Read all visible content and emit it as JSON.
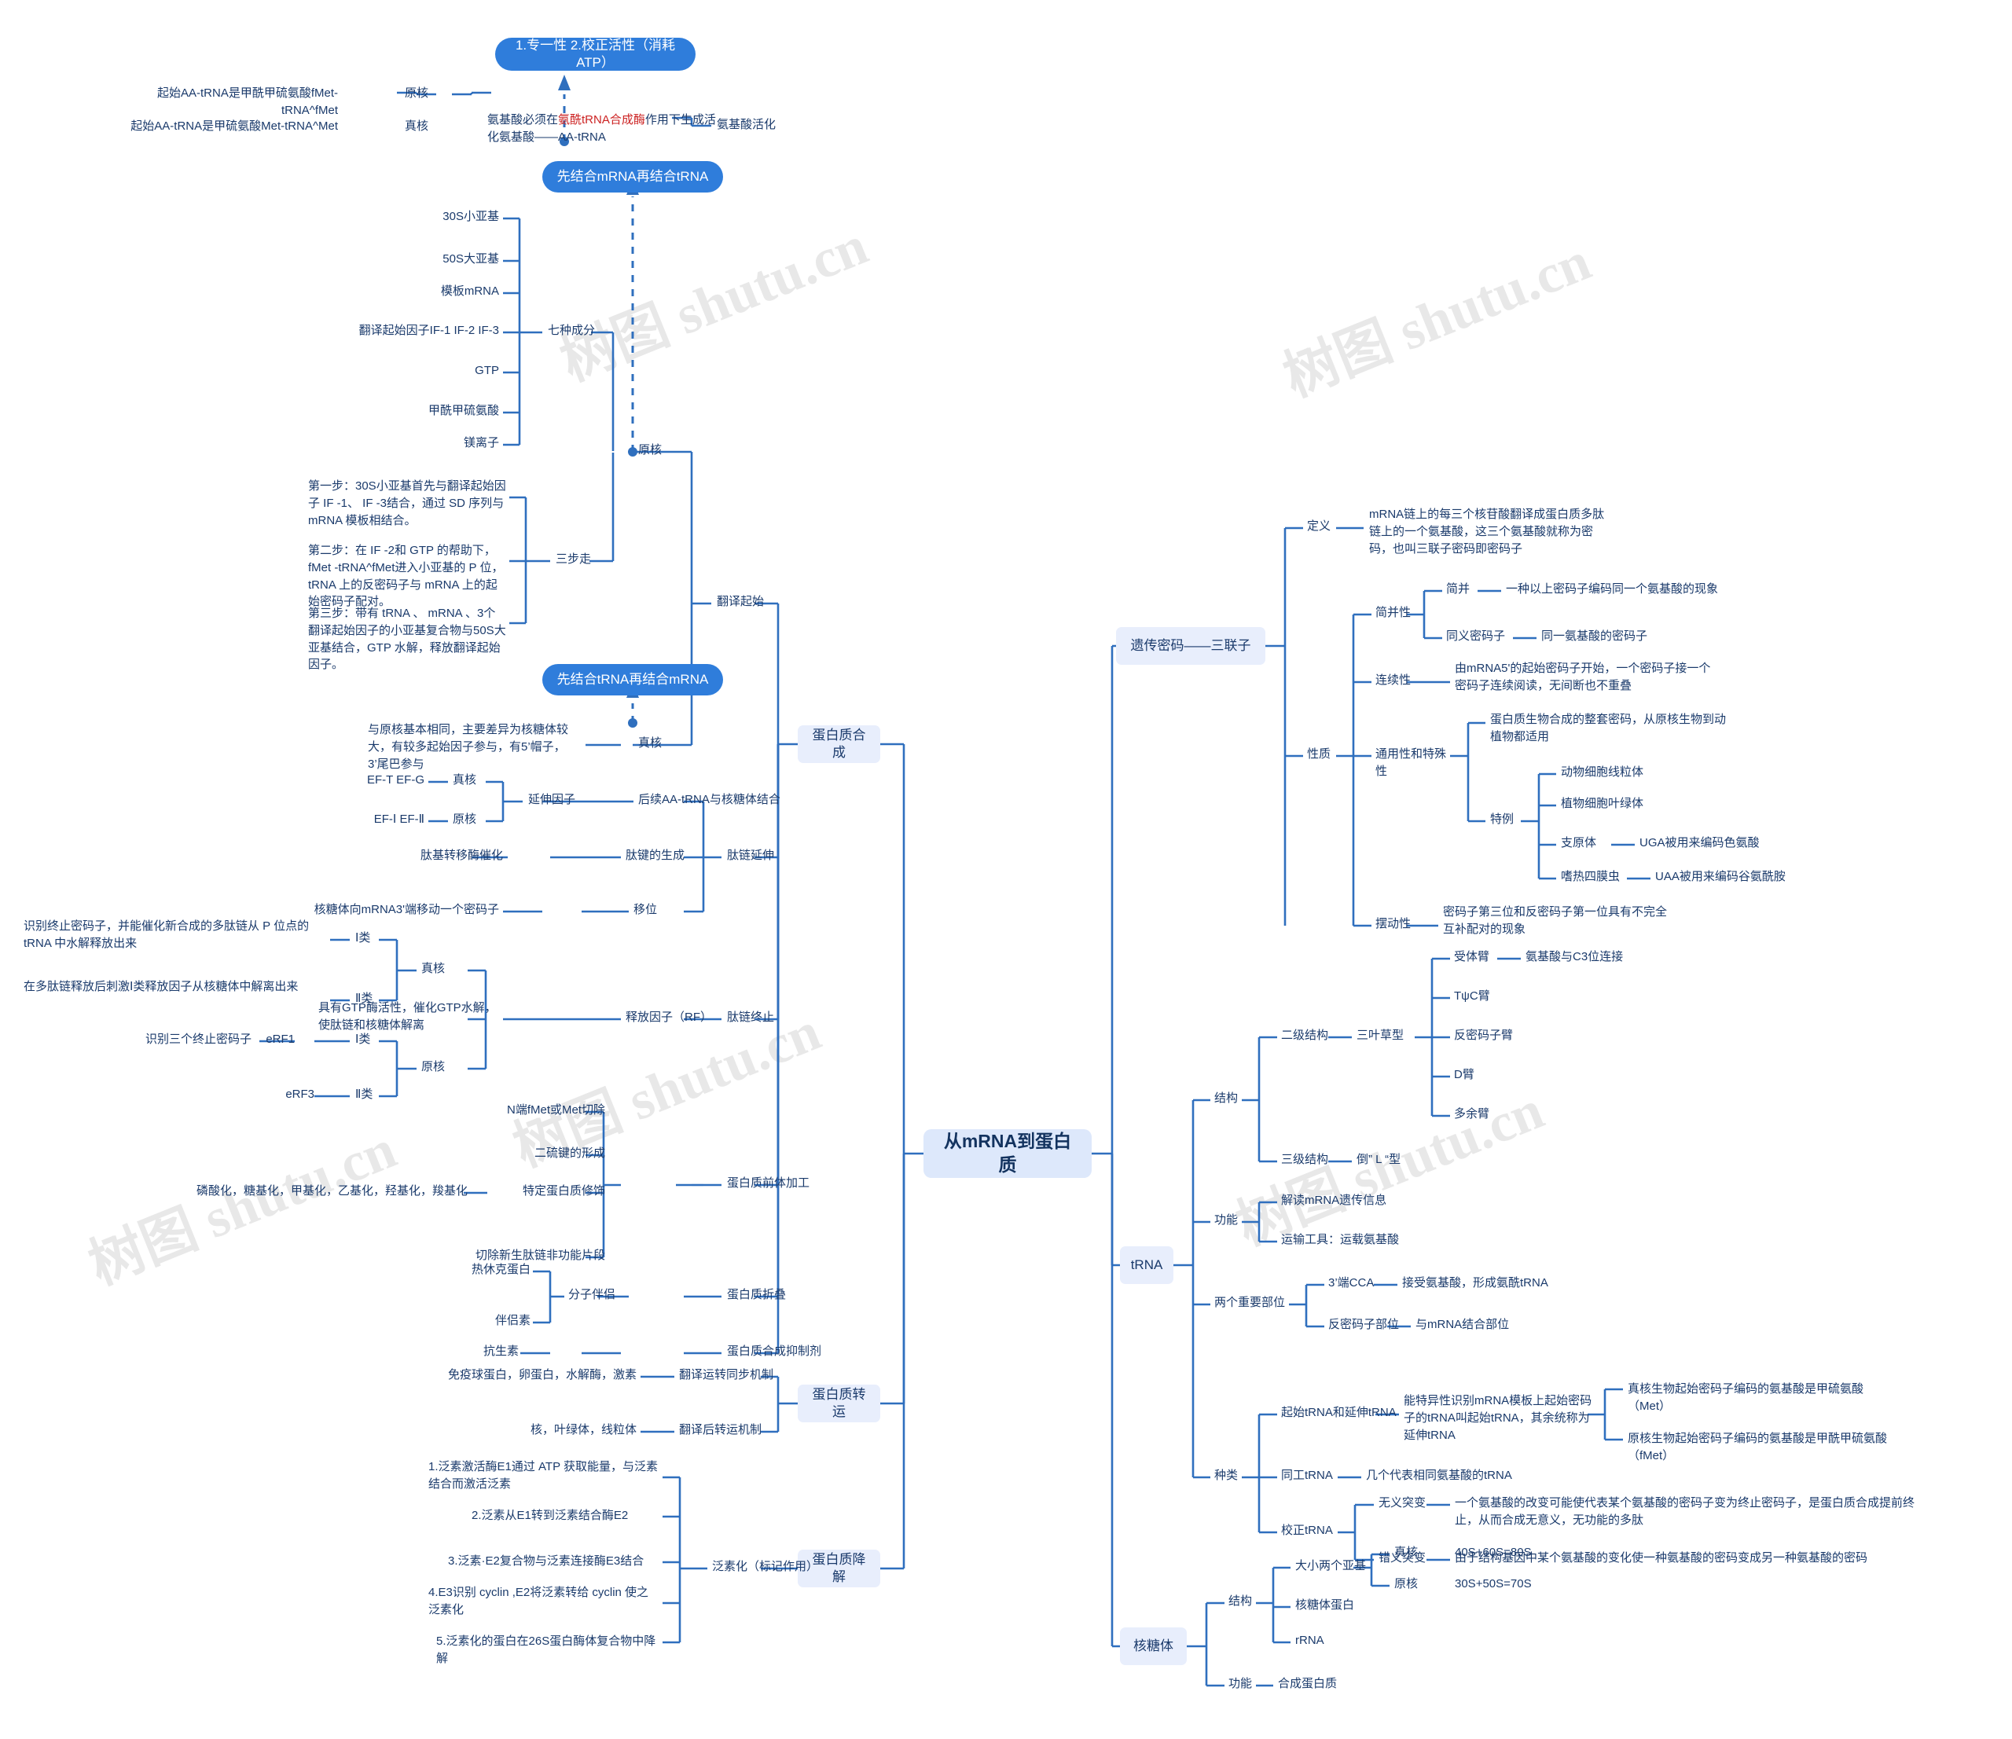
{
  "root": {
    "label": "从mRNA到蛋白质"
  },
  "watermark": {
    "text": "树图 shutu.cn"
  },
  "branches": {
    "protein_synthesis": {
      "label": "蛋白质合成"
    },
    "protein_transport": {
      "label": "蛋白质转运"
    },
    "protein_degradation": {
      "label": "蛋白质降解"
    },
    "genetic_code": {
      "label": "遗传密码——三联子"
    },
    "trna": {
      "label": "tRNA"
    },
    "ribosome": {
      "label": "核糖体"
    }
  },
  "aa_activation": {
    "label": "氨基酸活化",
    "desc_pre": "氨基酸必须在",
    "desc_red": "氨酰tRNA合成酶",
    "desc_post": "作用下生成活化氨基酸——AA-tRNA",
    "callout": "1.专一性    2.校正活性（消耗ATP）",
    "prokaryote": "原核",
    "eukaryote": "真核",
    "prok_detail": "起始AA-tRNA是甲酰甲硫氨酸fMet-tRNA^fMet",
    "euk_detail": "起始AA-tRNA是甲硫氨酸Met-tRNA^Met"
  },
  "initiation": {
    "label": "翻译起始",
    "prokaryote": "原核",
    "eukaryote": "真核",
    "callout_prok": "先结合mRNA再结合tRNA",
    "callout_euk": "先结合tRNA再结合mRNA",
    "seven_components_label": "七种成分",
    "seven_components": [
      "30S小亚基",
      "50S大亚基",
      "模板mRNA",
      "翻译起始因子IF-1 IF-2 IF-3",
      "GTP",
      "甲酰甲硫氨酸",
      "镁离子"
    ],
    "three_steps_label": "三步走",
    "three_steps": [
      "第一步：30S小亚基首先与翻译起始因子 IF -1、 IF -3结合，通过 SD 序列与 mRNA 模板相结合。",
      "第二步：在 IF -2和 GTP 的帮助下， fMet -tRNA^fMet进入小亚基的 P 位， tRNA 上的反密码子与 mRNA 上的起始密码子配对。",
      "第三步：带有 tRNA 、 mRNA 、3个翻译起始因子的小亚基复合物与50S大亚基结合，GTP 水解，释放翻译起始因子。"
    ],
    "euk_detail": "与原核基本相同，主要差异为核糖体较大，有较多起始因子参与，有5’帽子，3’尾巴参与"
  },
  "elongation": {
    "label": "肽链延伸",
    "items": [
      {
        "mid": "后续AA-tRNA与核糖体结合",
        "sub": "延伸因子",
        "leaves": [
          {
            "text": "EF-T  EF-G",
            "tag": "真核"
          },
          {
            "text": "EF-Ⅰ  EF-Ⅱ",
            "tag": "原核"
          }
        ]
      },
      {
        "mid": "肽键的生成",
        "detail": "肽基转移酶催化"
      },
      {
        "mid": "移位",
        "detail": "核糖体向mRNA3'端移动一个密码子"
      }
    ]
  },
  "termination": {
    "label": "肽链终止",
    "rf_label": "释放因子（RF）",
    "rf_desc": "具有GTP酶活性，催化GTP水解，使肽链和核糖体解离",
    "eukaryote": "真核",
    "prokaryote": "原核",
    "euk_class1": "Ⅰ类",
    "euk_class2": "Ⅱ类",
    "euk_class1_desc": "识别终止密码子，并能催化新合成的多肽链从 P 位点的 tRNA 中水解释放出来",
    "euk_class2_desc": "在多肽链释放后刺激Ⅰ类释放因子从核糖体中解离出来",
    "prok_class1": "Ⅰ类",
    "prok_class2": "Ⅱ类",
    "prok_erf1": "eRF1",
    "prok_erf3": "eRF3",
    "prok_erf1_desc": "识别三个终止密码子"
  },
  "precursor": {
    "label": "蛋白质前体加工",
    "items": [
      {
        "text": "N端fMet或Met切除"
      },
      {
        "text": "二硫键的形成"
      },
      {
        "text": "特定蛋白质修饰",
        "detail": "磷酸化，糖基化，甲基化，乙基化，羟基化，羧基化"
      },
      {
        "text": "切除新生肽链非功能片段"
      }
    ]
  },
  "folding": {
    "label": "蛋白质折叠",
    "chaperone": "分子伴侣",
    "items": [
      "热休克蛋白",
      "伴侣素"
    ]
  },
  "inhibitor": {
    "label": "蛋白质合成抑制剂",
    "detail": "抗生素"
  },
  "transport": {
    "items": [
      {
        "label": "翻译运转同步机制",
        "detail": "免疫球蛋白，卵蛋白，水解酶，激素"
      },
      {
        "label": "翻译后转运机制",
        "detail": "核，叶绿体，线粒体"
      }
    ]
  },
  "degradation": {
    "label": "泛素化（标记作用）",
    "steps": [
      "1.泛素激活酶E1通过 ATP 获取能量，与泛素结合而激活泛素",
      "2.泛素从E1转到泛素结合酶E2",
      "3.泛素·E2复合物与泛素连接酶E3结合",
      "4.E3识别 cyclin ,E2将泛素转给 cyclin 使之泛素化",
      "5.泛素化的蛋白在26S蛋白酶体复合物中降解"
    ]
  },
  "genetic_code_detail": {
    "definition_label": "定义",
    "definition": "mRNA链上的每三个核苷酸翻译成蛋白质多肽链上的一个氨基酸，这三个氨基酸就称为密码，也叫三联子密码即密码子",
    "properties_label": "性质",
    "degeneracy_label": "简并性",
    "degeneracy_items": [
      {
        "name": "简并",
        "desc": "一种以上密码子编码同一个氨基酸的现象"
      },
      {
        "name": "同义密码子",
        "desc": "同一氨基酸的密码子"
      }
    ],
    "continuity_label": "连续性",
    "continuity_desc": "由mRNA5'的起始密码子开始，一个密码子接一个密码子连续阅读，无间断也不重叠",
    "universality_label": "通用性和特殊性",
    "universality_desc": "蛋白质生物合成的整套密码，从原核生物到动植物都适用",
    "special_label": "特例",
    "special_items": [
      {
        "name": "动物细胞线粒体",
        "desc": ""
      },
      {
        "name": "植物细胞叶绿体",
        "desc": ""
      },
      {
        "name": "支原体",
        "desc": "UGA被用来编码色氨酸"
      },
      {
        "name": "嗜热四膜虫",
        "desc": "UAA被用来编码谷氨酰胺"
      }
    ],
    "wobble_label": "摆动性",
    "wobble_desc": "密码子第三位和反密码子第一位具有不完全互补配对的现象"
  },
  "trna_detail": {
    "structure_label": "结构",
    "secondary_label": "二级结构",
    "secondary_value": "三叶草型",
    "arms": [
      {
        "name": "受体臂",
        "desc": "氨基酸与C3位连接"
      },
      {
        "name": "TψC臂",
        "desc": ""
      },
      {
        "name": "反密码子臂",
        "desc": ""
      },
      {
        "name": "D臂",
        "desc": ""
      },
      {
        "name": "多余臂",
        "desc": ""
      }
    ],
    "tertiary_label": "三级结构",
    "tertiary_value": "倒” L “型",
    "function_label": "功能",
    "functions": [
      "解读mRNA遗传信息",
      "运输工具：运载氨基酸"
    ],
    "sites_label": "两个重要部位",
    "sites": [
      {
        "name": "3’端CCA",
        "desc": "接受氨基酸，形成氨酰tRNA"
      },
      {
        "name": "反密码子部位",
        "desc": "与mRNA结合部位"
      }
    ],
    "types_label": "种类",
    "types": [
      {
        "name": "起始tRNA和延伸tRNA",
        "desc": "能特异性识别mRNA模板上起始密码子的tRNA叫起始tRNA，其余统称为延伸tRNA",
        "subs": [
          "真核生物起始密码子编码的氨基酸是甲硫氨酸（Met）",
          "原核生物起始密码子编码的氨基酸是甲酰甲硫氨酸（fMet）"
        ]
      },
      {
        "name": "同工tRNA",
        "desc": "几个代表相同氨基酸的tRNA"
      },
      {
        "name": "校正tRNA",
        "desc": "",
        "subs2": [
          {
            "name": "无义突变",
            "desc": "一个氨基酸的改变可能使代表某个氨基酸的密码子变为终止密码子，是蛋白质合成提前终止，从而合成无意义，无功能的多肽"
          },
          {
            "name": "错义突变",
            "desc": "由于结构基因中某个氨基酸的变化使一种氨基酸的密码变成另一种氨基酸的密码"
          }
        ]
      }
    ]
  },
  "ribosome_detail": {
    "structure_label": "结构",
    "subunits_label": "大小两个亚基",
    "subunits": [
      {
        "name": "真核",
        "value": "40S+60S=80S"
      },
      {
        "name": "原核",
        "value": "30S+50S=70S"
      }
    ],
    "protein_label": "核糖体蛋白",
    "rrna_label": "rRNA",
    "function_label": "功能",
    "function_value": "合成蛋白质"
  }
}
